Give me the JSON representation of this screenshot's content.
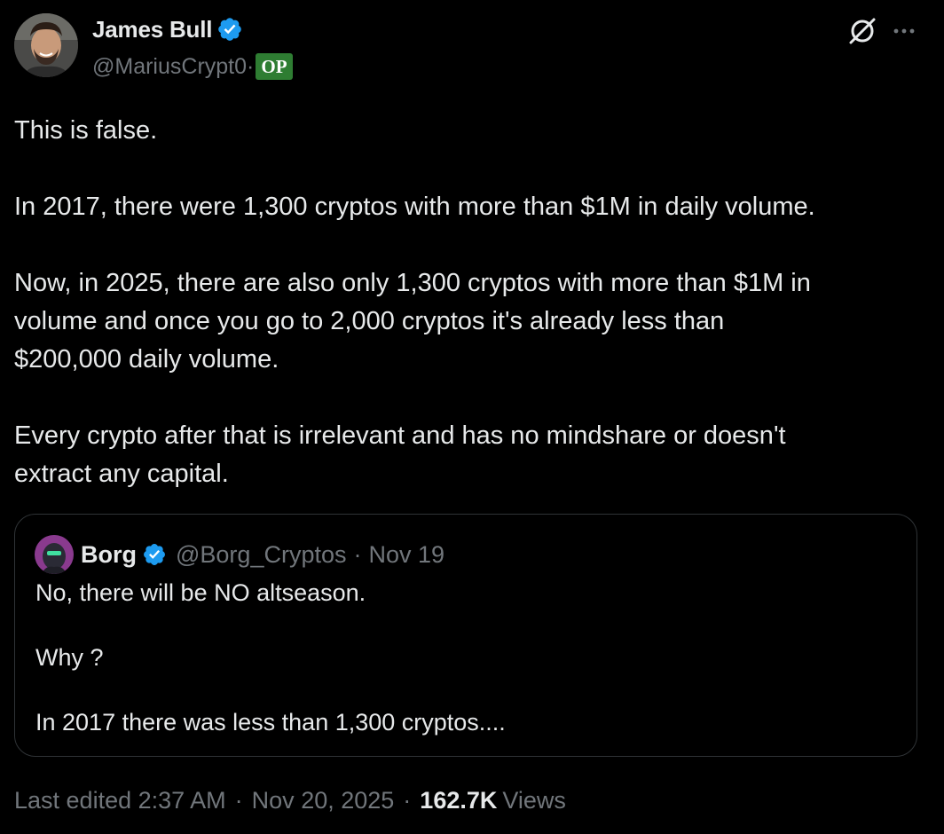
{
  "author": {
    "name": "James Bull",
    "handle": "@MariusCrypt0",
    "handle_separator": "·",
    "op_badge": "OP",
    "verified": true
  },
  "header_icons": {
    "grok": "grok-slash-icon",
    "more": "more-dots-icon"
  },
  "tweet_text": {
    "p1": "This is false.",
    "p2": "In 2017, there were 1,300 cryptos with more than $1M in daily volume.",
    "p3_line1": "Now, in 2025, there are also only 1,300 cryptos with more than $1M in",
    "p3_line2": "volume and once you go to 2,000 cryptos it's already less than",
    "p3_line3": "$200,000 daily volume.",
    "p4_line1": "Every crypto after that is irrelevant and has no mindshare or doesn't",
    "p4_line2": "extract any capital."
  },
  "quote": {
    "name": "Borg",
    "handle": "@Borg_Cryptos",
    "separator": "·",
    "date": "Nov 19",
    "verified": true,
    "line1": "No, there will be NO altseason.",
    "line2": "Why ?",
    "line3": "In 2017 there was less than 1,300 cryptos...."
  },
  "meta": {
    "edited": "Last edited 2:37 AM",
    "separator1": "·",
    "date": "Nov 20, 2025",
    "separator2": "·",
    "views_count": "162.7K",
    "views_label": "Views"
  },
  "colors": {
    "background": "#000000",
    "text_primary": "#e7e9ea",
    "text_secondary": "#71767b",
    "verified_blue": "#1d9bf0",
    "op_green": "#2e7d32",
    "border": "#2f3336"
  }
}
